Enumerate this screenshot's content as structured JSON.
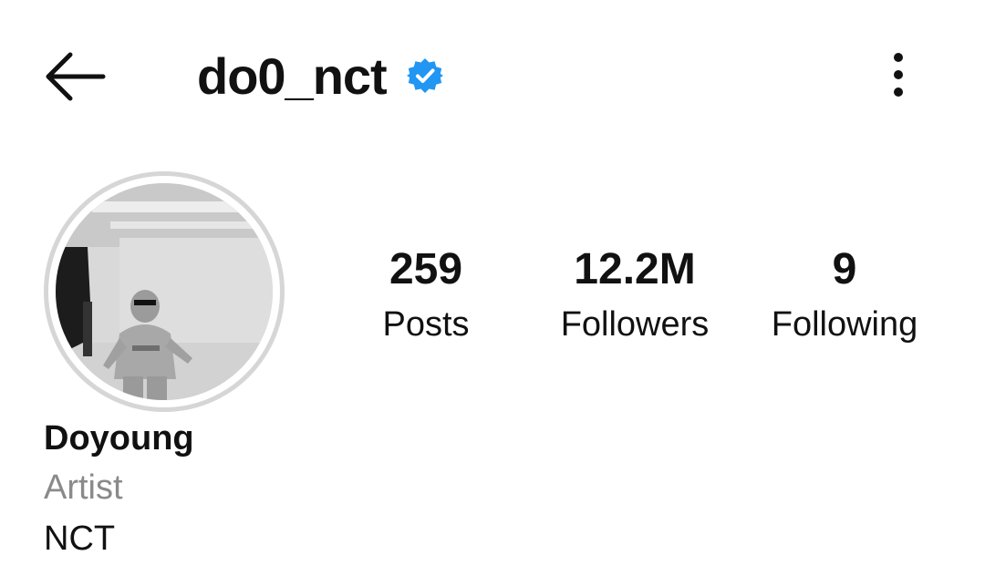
{
  "header": {
    "username": "do0_nct",
    "verified": true,
    "back_icon": "arrow-left-icon",
    "more_icon": "more-vertical-icon"
  },
  "profile": {
    "avatar_icon": "profile-photo",
    "stats": {
      "posts": {
        "value": "259",
        "label": "Posts"
      },
      "followers": {
        "value": "12.2M",
        "label": "Followers"
      },
      "following": {
        "value": "9",
        "label": "Following"
      }
    },
    "name": "Doyoung",
    "category": "Artist",
    "bio": "NCT"
  },
  "colors": {
    "verified_badge": "#2196f3",
    "category_text": "#8a8a8a",
    "avatar_ring": "#d6d6d6"
  }
}
